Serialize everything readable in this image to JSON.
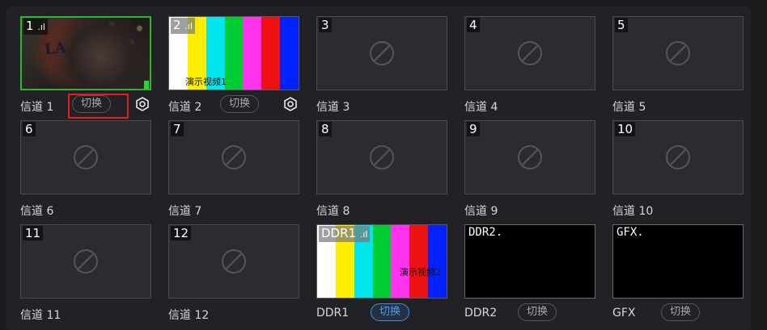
{
  "switch_label": "切换",
  "cells": [
    {
      "num": "1",
      "label": "信道 1",
      "type": "live",
      "signal": ".ıl"
    },
    {
      "num": "2",
      "label": "信道 2",
      "type": "bars",
      "signal": ".ıl",
      "caption": "演示视频1"
    },
    {
      "num": "3",
      "label": "信道 3"
    },
    {
      "num": "4",
      "label": "信道 4"
    },
    {
      "num": "5",
      "label": "信道 5"
    },
    {
      "num": "6",
      "label": "信道 6"
    },
    {
      "num": "7",
      "label": "信道 7"
    },
    {
      "num": "8",
      "label": "信道 8"
    },
    {
      "num": "9",
      "label": "信道 9"
    },
    {
      "num": "10",
      "label": "信道 10"
    },
    {
      "num": "11",
      "label": "信道 11"
    },
    {
      "num": "12",
      "label": "信道 12"
    },
    {
      "num": "DDR1",
      "label": "DDR1",
      "type": "bars",
      "signal": ".ıl",
      "caption": "演示视频2"
    },
    {
      "num": "DDR2",
      "label": "DDR2",
      "type": "black",
      "screen_text": "DDR2."
    },
    {
      "num": "GFX",
      "label": "GFX",
      "type": "black",
      "screen_text": "GFX."
    }
  ],
  "colors": {
    "bars": [
      "#ffffff",
      "#ffee00",
      "#00e5ee",
      "#00cc33",
      "#ff33ee",
      "#ee1111",
      "#0022ff"
    ],
    "live_border": "#2fb52f",
    "highlight": "#e02020",
    "active_switch": "#3d8fe0"
  },
  "icons": {
    "empty": "no-signal-icon",
    "settings": "settings-icon"
  }
}
